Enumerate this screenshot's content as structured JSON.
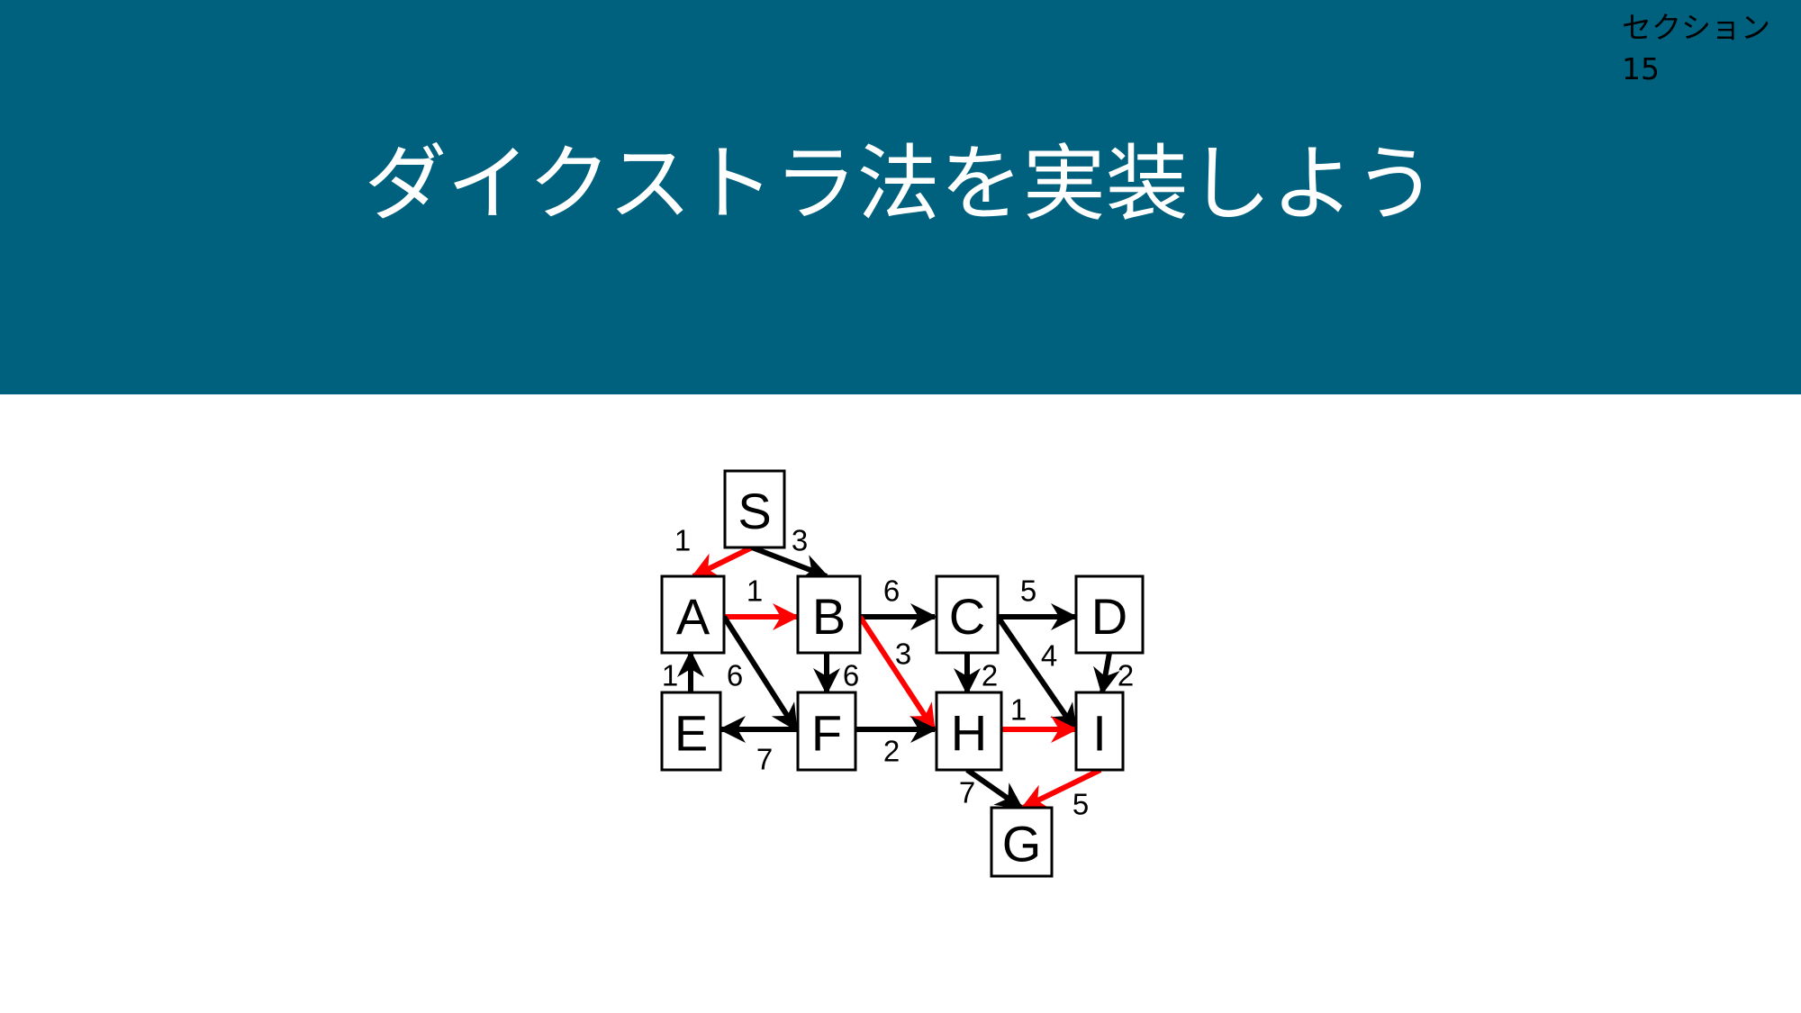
{
  "header": {
    "title": "ダイクストラ法を実装しよう",
    "section_label": "セクション",
    "section_number": "15",
    "background_color": "#00617f"
  },
  "graph": {
    "highlight_color": "#ff0000",
    "edge_color": "#000000",
    "nodes": [
      {
        "id": "S",
        "label": "S"
      },
      {
        "id": "A",
        "label": "A"
      },
      {
        "id": "B",
        "label": "B"
      },
      {
        "id": "C",
        "label": "C"
      },
      {
        "id": "D",
        "label": "D"
      },
      {
        "id": "E",
        "label": "E"
      },
      {
        "id": "F",
        "label": "F"
      },
      {
        "id": "H",
        "label": "H"
      },
      {
        "id": "I",
        "label": "I"
      },
      {
        "id": "G",
        "label": "G"
      }
    ],
    "edges": [
      {
        "from": "S",
        "to": "A",
        "weight": "1",
        "highlighted": true
      },
      {
        "from": "S",
        "to": "B",
        "weight": "3",
        "highlighted": false
      },
      {
        "from": "A",
        "to": "B",
        "weight": "1",
        "highlighted": true
      },
      {
        "from": "A",
        "to": "F",
        "weight": "6",
        "highlighted": false
      },
      {
        "from": "E",
        "to": "A",
        "weight": "1",
        "highlighted": false
      },
      {
        "from": "B",
        "to": "C",
        "weight": "6",
        "highlighted": false
      },
      {
        "from": "B",
        "to": "F",
        "weight": "6",
        "highlighted": false
      },
      {
        "from": "B",
        "to": "H",
        "weight": "3",
        "highlighted": true
      },
      {
        "from": "C",
        "to": "D",
        "weight": "5",
        "highlighted": false
      },
      {
        "from": "C",
        "to": "H",
        "weight": "2",
        "highlighted": false
      },
      {
        "from": "C",
        "to": "I",
        "weight": "4",
        "highlighted": false
      },
      {
        "from": "D",
        "to": "I",
        "weight": "2",
        "highlighted": false
      },
      {
        "from": "F",
        "to": "E",
        "weight": "7",
        "highlighted": false
      },
      {
        "from": "F",
        "to": "H",
        "weight": "2",
        "highlighted": false
      },
      {
        "from": "H",
        "to": "I",
        "weight": "1",
        "highlighted": true
      },
      {
        "from": "H",
        "to": "G",
        "weight": "7",
        "highlighted": false
      },
      {
        "from": "I",
        "to": "G",
        "weight": "5",
        "highlighted": true
      }
    ]
  }
}
